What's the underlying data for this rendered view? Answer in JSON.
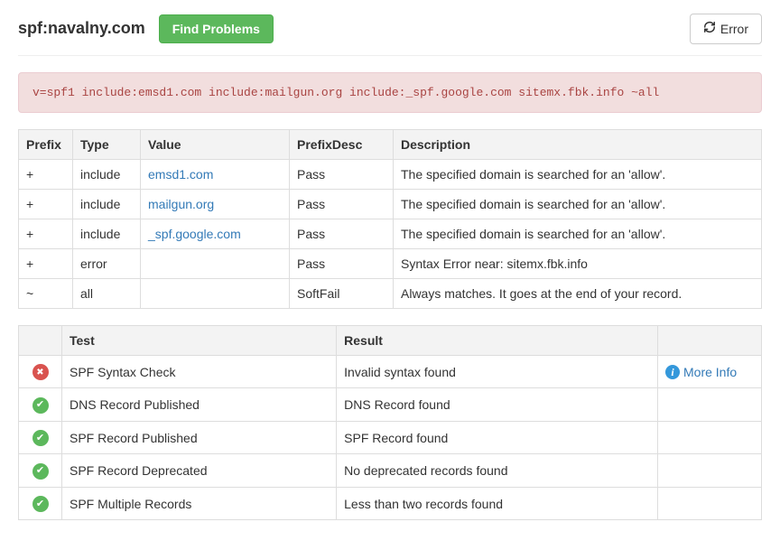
{
  "header": {
    "title": "spf:navalny.com",
    "find_problems_label": "Find Problems",
    "error_label": "Error"
  },
  "spf_record": "v=spf1 include:emsd1.com include:mailgun.org include:_spf.google.com sitemx.fbk.info ~all",
  "spf_table": {
    "headers": [
      "Prefix",
      "Type",
      "Value",
      "PrefixDesc",
      "Description"
    ],
    "rows": [
      {
        "prefix": "+",
        "type": "include",
        "value": "emsd1.com",
        "value_link": true,
        "prefixdesc": "Pass",
        "description": "The specified domain is searched for an 'allow'."
      },
      {
        "prefix": "+",
        "type": "include",
        "value": "mailgun.org",
        "value_link": true,
        "prefixdesc": "Pass",
        "description": "The specified domain is searched for an 'allow'."
      },
      {
        "prefix": "+",
        "type": "include",
        "value": "_spf.google.com",
        "value_link": true,
        "prefixdesc": "Pass",
        "description": "The specified domain is searched for an 'allow'."
      },
      {
        "prefix": "+",
        "type": "error",
        "value": "",
        "value_link": false,
        "prefixdesc": "Pass",
        "description": "Syntax Error near: sitemx.fbk.info"
      },
      {
        "prefix": "~",
        "type": "all",
        "value": "",
        "value_link": false,
        "prefixdesc": "SoftFail",
        "description": "Always matches. It goes at the end of your record."
      }
    ]
  },
  "test_table": {
    "headers": {
      "test": "Test",
      "result": "Result"
    },
    "more_info_label": "More Info",
    "rows": [
      {
        "status": "error",
        "test": "SPF Syntax Check",
        "result": "Invalid syntax found",
        "more_info": true
      },
      {
        "status": "ok",
        "test": "DNS Record Published",
        "result": "DNS Record found",
        "more_info": false
      },
      {
        "status": "ok",
        "test": "SPF Record Published",
        "result": "SPF Record found",
        "more_info": false
      },
      {
        "status": "ok",
        "test": "SPF Record Deprecated",
        "result": "No deprecated records found",
        "more_info": false
      },
      {
        "status": "ok",
        "test": "SPF Multiple Records",
        "result": "Less than two records found",
        "more_info": false
      }
    ]
  }
}
